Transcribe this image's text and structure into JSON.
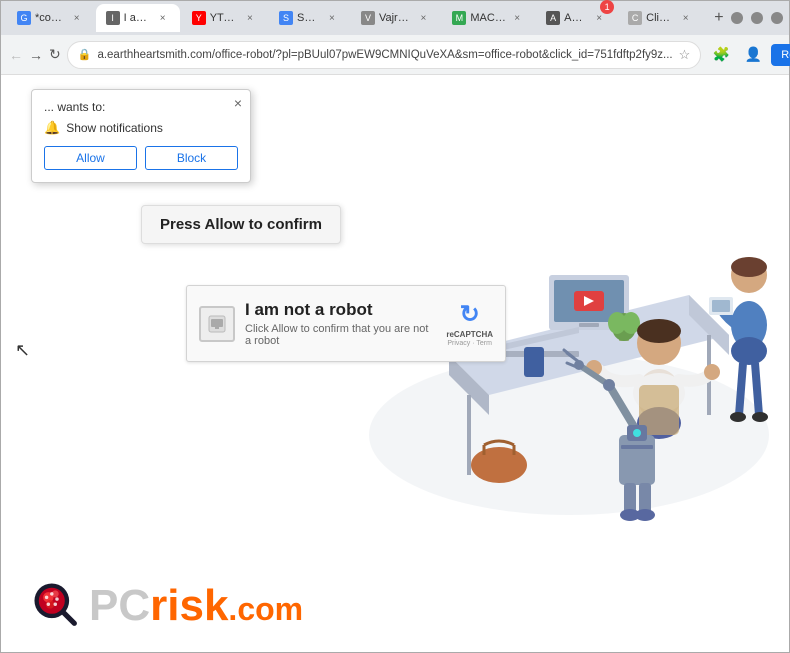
{
  "browser": {
    "tabs": [
      {
        "id": "tab1",
        "label": "*combi...",
        "active": false,
        "favicon": "G"
      },
      {
        "id": "tab2",
        "label": "I am n...",
        "active": true,
        "favicon": "I"
      },
      {
        "id": "tab3",
        "label": "YTube...",
        "active": false,
        "favicon": "Y"
      },
      {
        "id": "tab4",
        "label": "Search",
        "active": false,
        "favicon": "S"
      },
      {
        "id": "tab5",
        "label": "VajraSy...",
        "active": false,
        "favicon": "V"
      },
      {
        "id": "tab6",
        "label": "MACPC...",
        "active": false,
        "favicon": "M"
      },
      {
        "id": "tab7",
        "label": "Apple",
        "active": false,
        "favicon": "A",
        "badge": "1"
      },
      {
        "id": "tab8",
        "label": "Click *...",
        "active": false,
        "favicon": "C"
      }
    ],
    "address": "a.earthheartsmith.com/office-robot/?pl=pBUul07pwEW9CMNIQuVeXA&sm=office-robot&click_id=751fdftp2fy9z...",
    "relaunch_label": "Relaunch to update"
  },
  "notification_popup": {
    "wants_to": "... wants to:",
    "notification_text": "Show notifications",
    "allow_label": "Allow",
    "block_label": "Block",
    "close_label": "×"
  },
  "press_allow": {
    "label": "Press Allow to confirm"
  },
  "recaptcha": {
    "title": "I am not a robot",
    "subtitle": "Click Allow to confirm that you are not a robot",
    "logo_line1": "reCAPTCHA",
    "logo_line2": "Privacy · Term"
  },
  "pcrisk": {
    "pc_text": "PC",
    "risk_text": "risk",
    "dotcom_text": ".com"
  },
  "icons": {
    "back": "←",
    "forward": "→",
    "refresh": "↻",
    "lock": "🔒",
    "star": "☆",
    "profile": "👤",
    "menu": "⋮",
    "extensions": "🧩",
    "bell": "🔔",
    "new_tab": "+",
    "close": "×",
    "cursor": "↖"
  }
}
